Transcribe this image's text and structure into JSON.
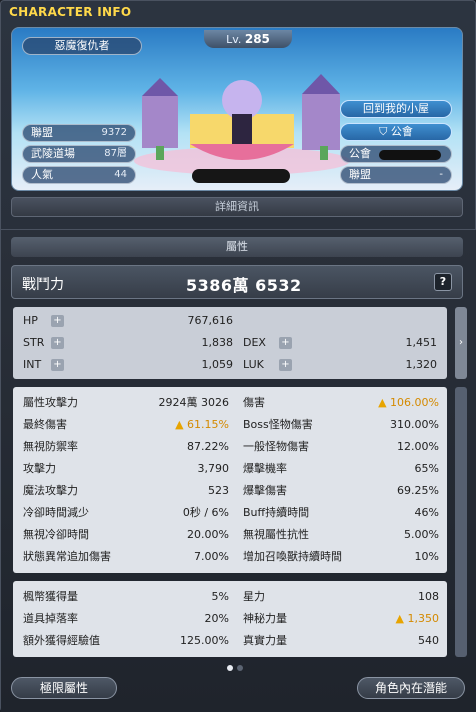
{
  "window": {
    "title": "CHARACTER INFO"
  },
  "banner": {
    "level_prefix": "Lv.",
    "level": "285",
    "job": "惡魔復仇者",
    "left_stats": [
      {
        "label": "聯盟",
        "value": "9372"
      },
      {
        "label": "武陵道場",
        "value": "87層"
      },
      {
        "label": "人氣",
        "value": "44"
      }
    ],
    "home_button": "回到我的小屋",
    "guild_button": "公會",
    "guild_label": "公會",
    "union_label": "聯盟",
    "union_value": "-"
  },
  "detail_button": "詳細資訊",
  "attributes": {
    "header": "屬性",
    "combat_power_label": "戰鬥力",
    "combat_power_value": "5386萬 6532",
    "help_label": "?",
    "base": [
      {
        "key": "HP",
        "value": "767,616"
      },
      {
        "key": "STR",
        "value": "1,838"
      },
      {
        "key": "DEX",
        "value": "1,451"
      },
      {
        "key": "INT",
        "value": "1,059"
      },
      {
        "key": "LUK",
        "value": "1,320"
      }
    ],
    "plus_icon": "+",
    "detail_left": [
      {
        "key": "屬性攻擊力",
        "value": "2924萬 3026"
      },
      {
        "key": "最終傷害",
        "value": "61.15%"
      },
      {
        "key": "無視防禦率",
        "value": "87.22%"
      },
      {
        "key": "攻擊力",
        "value": "3,790"
      },
      {
        "key": "魔法攻擊力",
        "value": "523"
      },
      {
        "key": "冷卻時間減少",
        "value": "0秒 / 6%"
      },
      {
        "key": "無視冷卻時間",
        "value": "20.00%"
      },
      {
        "key": "狀態異常追加傷害",
        "value": "7.00%"
      }
    ],
    "detail_right": [
      {
        "key": "傷害",
        "value": "106.00%"
      },
      {
        "key": "Boss怪物傷害",
        "value": "310.00%"
      },
      {
        "key": "一般怪物傷害",
        "value": "12.00%"
      },
      {
        "key": "爆擊機率",
        "value": "65%"
      },
      {
        "key": "爆擊傷害",
        "value": "69.25%"
      },
      {
        "key": "Buff持續時間",
        "value": "46%"
      },
      {
        "key": "無視屬性抗性",
        "value": "5.00%"
      },
      {
        "key": "增加召喚獸持續時間",
        "value": "10%"
      }
    ],
    "extra_left": [
      {
        "key": "楓幣獲得量",
        "value": "5%"
      },
      {
        "key": "道具掉落率",
        "value": "20%"
      },
      {
        "key": "額外獲得經驗值",
        "value": "125.00%"
      }
    ],
    "extra_right": [
      {
        "key": "星力",
        "value": "108"
      },
      {
        "key": "神秘力量",
        "value": "1,350"
      },
      {
        "key": "真實力量",
        "value": "540"
      }
    ],
    "up_arrow": "▲"
  },
  "buttons": {
    "left": "極限屬性",
    "right": "角色內在潛能"
  },
  "colors": {
    "title": "#ffd94a",
    "highlight": "#e7a400"
  }
}
